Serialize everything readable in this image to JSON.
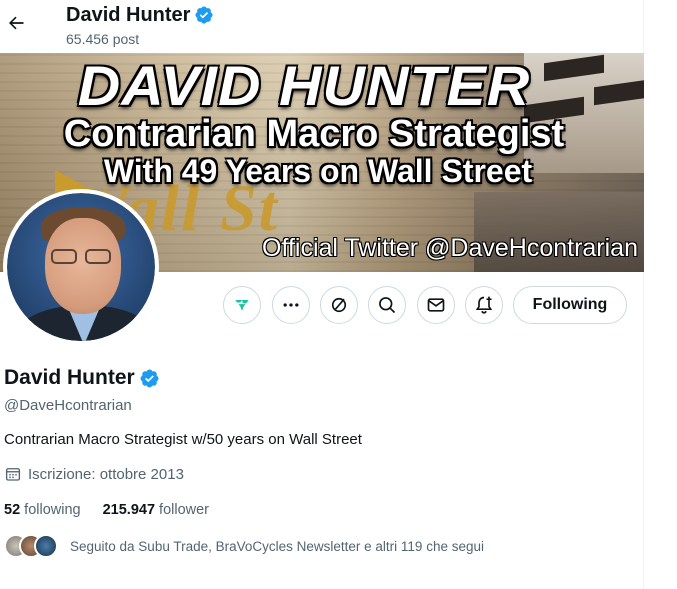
{
  "header": {
    "back_icon": "arrow-left-icon",
    "name": "David Hunter",
    "post_count": "65.456 post"
  },
  "banner": {
    "line1": "DAVID HUNTER",
    "line2": "Contrarian Macro Strategist",
    "line3": "With 49 Years on Wall Street",
    "sign": "Wall St",
    "handle": "Official Twitter @DaveHcontrarian"
  },
  "actions": {
    "icons": [
      "grok-icon",
      "more-icon",
      "block-icon",
      "search-icon",
      "message-icon",
      "notification-bell-icon"
    ],
    "follow_label": "Following"
  },
  "profile": {
    "name": "David Hunter",
    "verified_icon": "verified-badge-icon",
    "handle": "@DaveHcontrarian",
    "bio": "Contrarian Macro Strategist w/50 years on Wall Street",
    "joined": "Iscrizione: ottobre 2013",
    "following_count": "52",
    "following_label": "following",
    "followers_count": "215.947",
    "followers_label": "follower",
    "followed_by": "Seguito da Subu Trade, BraVoCycles Newsletter e altri 119 che segui"
  },
  "colors": {
    "verified": "#1d9bf0",
    "secondary_text": "#536471",
    "border": "#cfd9de"
  }
}
